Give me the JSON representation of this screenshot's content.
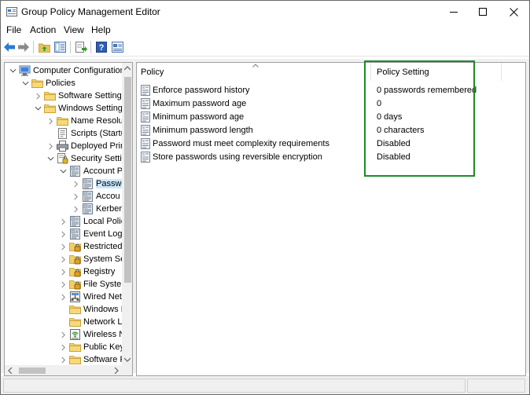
{
  "window": {
    "title": "Group Policy Management Editor",
    "controls": {
      "minimize": "minimize-icon",
      "maximize": "maximize-icon",
      "close": "close-icon"
    }
  },
  "menu": {
    "items": [
      "File",
      "Action",
      "View",
      "Help"
    ]
  },
  "toolbar": {
    "buttons": [
      "back-arrow-icon",
      "forward-arrow-icon",
      "up-folder-icon",
      "show-hide-tree-icon",
      "export-list-icon",
      "help-icon",
      "properties-icon"
    ]
  },
  "tree": {
    "items": [
      {
        "label": "Computer Configuration",
        "icon": "computer-icon",
        "expanded": true
      },
      {
        "label": "Policies",
        "icon": "folder-icon",
        "expanded": true
      },
      {
        "label": "Software Settings",
        "icon": "folder-icon",
        "expanded": false
      },
      {
        "label": "Windows Settings",
        "icon": "folder-icon",
        "expanded": true
      },
      {
        "label": "Name Resolut",
        "icon": "folder-icon",
        "expanded": false
      },
      {
        "label": "Scripts (Startu",
        "icon": "script-icon",
        "expanded": false
      },
      {
        "label": "Deployed Prin",
        "icon": "printer-icon",
        "expanded": false
      },
      {
        "label": "Security Settin",
        "icon": "security-icon",
        "expanded": true
      },
      {
        "label": "Account P",
        "icon": "policy-book-icon",
        "expanded": true
      },
      {
        "label": "Passwo",
        "icon": "policy-book-icon",
        "expanded": false,
        "selected": true
      },
      {
        "label": "Accou",
        "icon": "policy-book-icon",
        "expanded": false
      },
      {
        "label": "Kerber",
        "icon": "policy-book-icon",
        "expanded": false
      },
      {
        "label": "Local Polic",
        "icon": "policy-book-icon",
        "expanded": false
      },
      {
        "label": "Event Log",
        "icon": "policy-book-icon",
        "expanded": false
      },
      {
        "label": "Restricted",
        "icon": "lock-folder-icon",
        "expanded": false
      },
      {
        "label": "System Se",
        "icon": "lock-folder-icon",
        "expanded": false
      },
      {
        "label": "Registry",
        "icon": "lock-folder-icon",
        "expanded": false
      },
      {
        "label": "File System",
        "icon": "lock-folder-icon",
        "expanded": false
      },
      {
        "label": "Wired Net",
        "icon": "network-icon",
        "expanded": false
      },
      {
        "label": "Windows I",
        "icon": "folder-icon",
        "expanded": false
      },
      {
        "label": "Network L",
        "icon": "folder-icon",
        "expanded": false
      },
      {
        "label": "Wireless N",
        "icon": "wireless-icon",
        "expanded": false
      },
      {
        "label": "Public Key",
        "icon": "folder-icon",
        "expanded": false
      },
      {
        "label": "Software R",
        "icon": "folder-icon",
        "expanded": false
      }
    ]
  },
  "details": {
    "columns": {
      "policy": "Policy",
      "setting": "Policy Setting"
    },
    "rows": [
      {
        "policy": "Enforce password history",
        "setting": "0 passwords remembered"
      },
      {
        "policy": "Maximum password age",
        "setting": "0"
      },
      {
        "policy": "Minimum password age",
        "setting": "0 days"
      },
      {
        "policy": "Minimum password length",
        "setting": "0 characters"
      },
      {
        "policy": "Password must meet complexity requirements",
        "setting": "Disabled"
      },
      {
        "policy": "Store passwords using reversible encryption",
        "setting": "Disabled"
      }
    ],
    "highlight_color": "#1e8a2a"
  }
}
